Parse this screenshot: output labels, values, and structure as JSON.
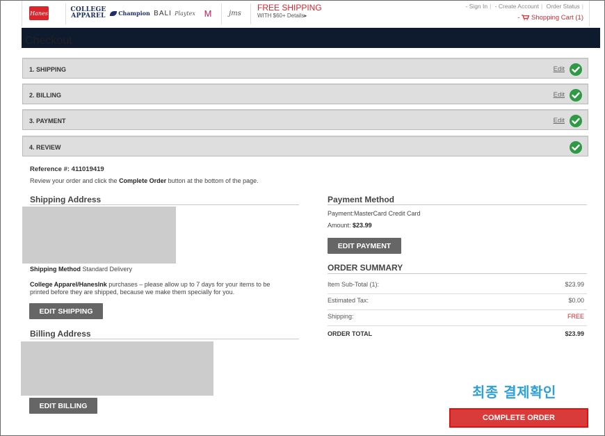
{
  "brand": {
    "hanes": "Hanes",
    "college_line1": "COLLEGE",
    "college_line2": "APPAREL",
    "champion": "Champion",
    "bali": "BALI",
    "playtex": "Playtex",
    "maidenform": "M",
    "jms": "jms"
  },
  "promo": {
    "title": "FREE SHIPPING",
    "subtitle": "WITH $60+ Details▸"
  },
  "toplinks": {
    "sign_in": "- Sign In",
    "create_account": "- Create Account",
    "order_status": "Order Status"
  },
  "cart": {
    "label": "Shopping Cart (1)",
    "prefix": "-"
  },
  "page_title": "Checkout",
  "steps": [
    {
      "label": "1. SHIPPING",
      "edit": "Edit"
    },
    {
      "label": "2. BILLING",
      "edit": "Edit"
    },
    {
      "label": "3. PAYMENT",
      "edit": "Edit"
    },
    {
      "label": "4. REVIEW",
      "edit": ""
    }
  ],
  "review": {
    "reference_label": "Reference #:",
    "reference_number": "411019419",
    "note_prefix": "Review your order and click the ",
    "note_bold": "Complete Order",
    "note_suffix": " button at the bottom of the page."
  },
  "shipping": {
    "title": "Shipping Address",
    "method_label": "Shipping Method",
    "method_value": "Standard Delivery",
    "notice_bold": "College Apparel/HanesInk",
    "notice_text1": " purchases – please allow up to 7 days for your items to be",
    "notice_text2": "printed before they are shipped, because we make them specially for you.",
    "edit_button": "EDIT SHIPPING"
  },
  "billing": {
    "title": "Billing Address",
    "edit_button": "EDIT BILLING"
  },
  "payment": {
    "title": "Payment Method",
    "payment_line": "Payment:MasterCard Credit Card",
    "amount_label": "Amount:",
    "amount_value": "$23.99",
    "edit_button": "EDIT PAYMENT"
  },
  "summary": {
    "title": "ORDER SUMMARY",
    "rows": [
      {
        "label": "Item Sub-Total (1):",
        "value": "$23.99"
      },
      {
        "label": "Estimated Tax:",
        "value": "$0.00"
      },
      {
        "label": "Shipping:",
        "value": "FREE"
      }
    ],
    "total_label": "ORDER TOTAL",
    "total_value": "$23.99"
  },
  "annotation": "최종 결제확인",
  "complete_button": "COMPLETE ORDER",
  "colors": {
    "accent_red": "#d8262c",
    "check_green": "#2e9a44",
    "header_navy": "#0e1a2e",
    "annotation_blue": "#2da0d8"
  }
}
